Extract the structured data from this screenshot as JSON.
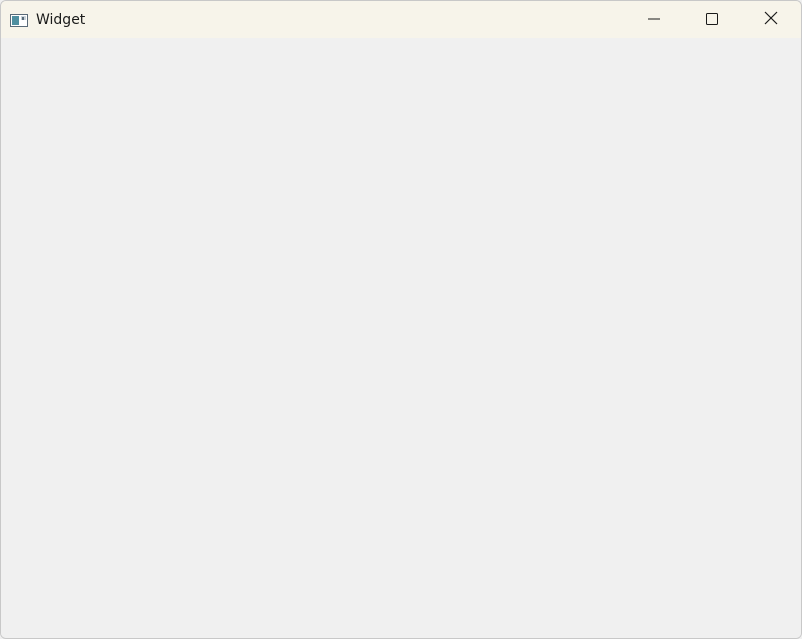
{
  "window": {
    "title": "Widget",
    "icons": {
      "app": "window-app-icon",
      "minimize": "minimize-icon",
      "maximize": "maximize-icon",
      "close": "close-icon"
    }
  },
  "colors": {
    "titlebar_bg": "#f7f4ea",
    "client_bg": "#f0f0f0",
    "title_text": "#1a1a1a"
  }
}
